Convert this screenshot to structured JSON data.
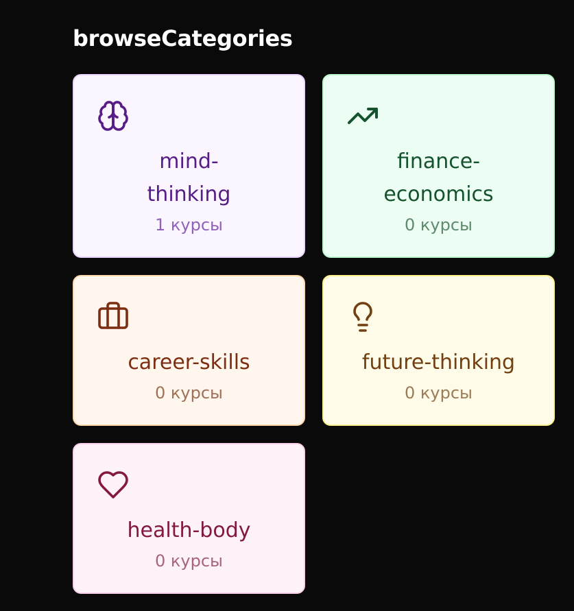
{
  "section": {
    "title": "browseCategories"
  },
  "categories": [
    {
      "name": "mind-thinking",
      "count": "1 курсы",
      "icon": "brain-icon",
      "theme": "purple",
      "color": "#581c87"
    },
    {
      "name": "finance-economics",
      "count": "0 курсы",
      "icon": "trending-up-icon",
      "theme": "green",
      "color": "#14532d"
    },
    {
      "name": "career-skills",
      "count": "0 курсы",
      "icon": "briefcase-icon",
      "theme": "orange",
      "color": "#7c2d12"
    },
    {
      "name": "future-thinking",
      "count": "0 курсы",
      "icon": "lightbulb-icon",
      "theme": "yellow",
      "color": "#713f12"
    },
    {
      "name": "health-body",
      "count": "0 курсы",
      "icon": "heart-icon",
      "theme": "pink",
      "color": "#831843"
    }
  ]
}
